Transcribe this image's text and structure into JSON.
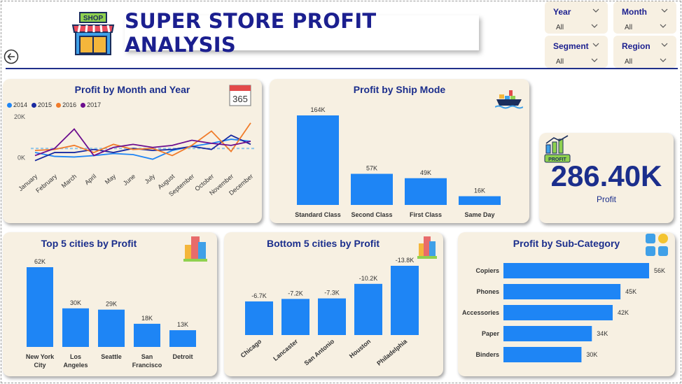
{
  "header": {
    "title": "SUPER STORE PROFIT ANALYSIS",
    "shop_sign": "SHOP"
  },
  "filters": [
    {
      "label": "Year",
      "value": "All"
    },
    {
      "label": "Month",
      "value": "All"
    },
    {
      "label": "Segment",
      "value": "All"
    },
    {
      "label": "Region",
      "value": "All"
    }
  ],
  "kpi": {
    "value": "286.40K",
    "label": "Profit",
    "badge": "PROFIT"
  },
  "calendar_icon_text": "365",
  "colors": {
    "accent": "#1e85f5",
    "title": "#1b2e8c",
    "card_bg": "#f7f0e2"
  },
  "chart_data": [
    {
      "type": "line",
      "title": "Profit by Month and Year",
      "x": [
        "January",
        "February",
        "March",
        "April",
        "May",
        "June",
        "July",
        "August",
        "September",
        "October",
        "November",
        "December"
      ],
      "yticks": [
        "20K",
        "0K"
      ],
      "ylim": [
        -4000,
        20000
      ],
      "average_line": 4500,
      "series": [
        {
          "name": "2014",
          "color": "#1e85f5",
          "values": [
            2500,
            600,
            300,
            1000,
            2000,
            1500,
            -800,
            3500,
            5500,
            7000,
            9000,
            8000
          ]
        },
        {
          "name": "2015",
          "color": "#1a2aa0",
          "values": [
            -1500,
            2500,
            2500,
            4000,
            2500,
            4500,
            3500,
            4000,
            5500,
            4000,
            11000,
            6500
          ]
        },
        {
          "name": "2016",
          "color": "#f07b2a",
          "values": [
            3500,
            4000,
            6000,
            2500,
            6500,
            4000,
            4500,
            1000,
            6000,
            13000,
            3000,
            17000
          ]
        },
        {
          "name": "2017",
          "color": "#6c0d8e",
          "values": [
            1000,
            4500,
            14000,
            1000,
            5000,
            6500,
            5000,
            6000,
            8500,
            7000,
            6000,
            8000
          ]
        }
      ]
    },
    {
      "type": "bar",
      "title": "Profit by Ship Mode",
      "categories": [
        "Standard Class",
        "Second Class",
        "First Class",
        "Same Day"
      ],
      "values": [
        164,
        57,
        49,
        16
      ],
      "labels": [
        "164K",
        "57K",
        "49K",
        "16K"
      ]
    },
    {
      "type": "bar",
      "title": "Top 5 cities by Profit",
      "categories": [
        "New York City",
        "Los Angeles",
        "Seattle",
        "San Francisco",
        "Detroit"
      ],
      "values": [
        62,
        30,
        29,
        18,
        13
      ],
      "labels": [
        "62K",
        "30K",
        "29K",
        "18K",
        "13K"
      ]
    },
    {
      "type": "bar",
      "title": "Bottom 5 cities by Profit",
      "categories": [
        "Chicago",
        "Lancaster",
        "San Antonio",
        "Houston",
        "Philadelphia"
      ],
      "values": [
        -6.7,
        -7.2,
        -7.3,
        -10.2,
        -13.8
      ],
      "labels": [
        "-6.7K",
        "-7.2K",
        "-7.3K",
        "-10.2K",
        "-13.8K"
      ]
    },
    {
      "type": "bar",
      "orientation": "horizontal",
      "title": "Profit by Sub-Category",
      "categories": [
        "Copiers",
        "Phones",
        "Accessories",
        "Paper",
        "Binders"
      ],
      "values": [
        56,
        45,
        42,
        34,
        30
      ],
      "labels": [
        "56K",
        "45K",
        "42K",
        "34K",
        "30K"
      ]
    }
  ]
}
